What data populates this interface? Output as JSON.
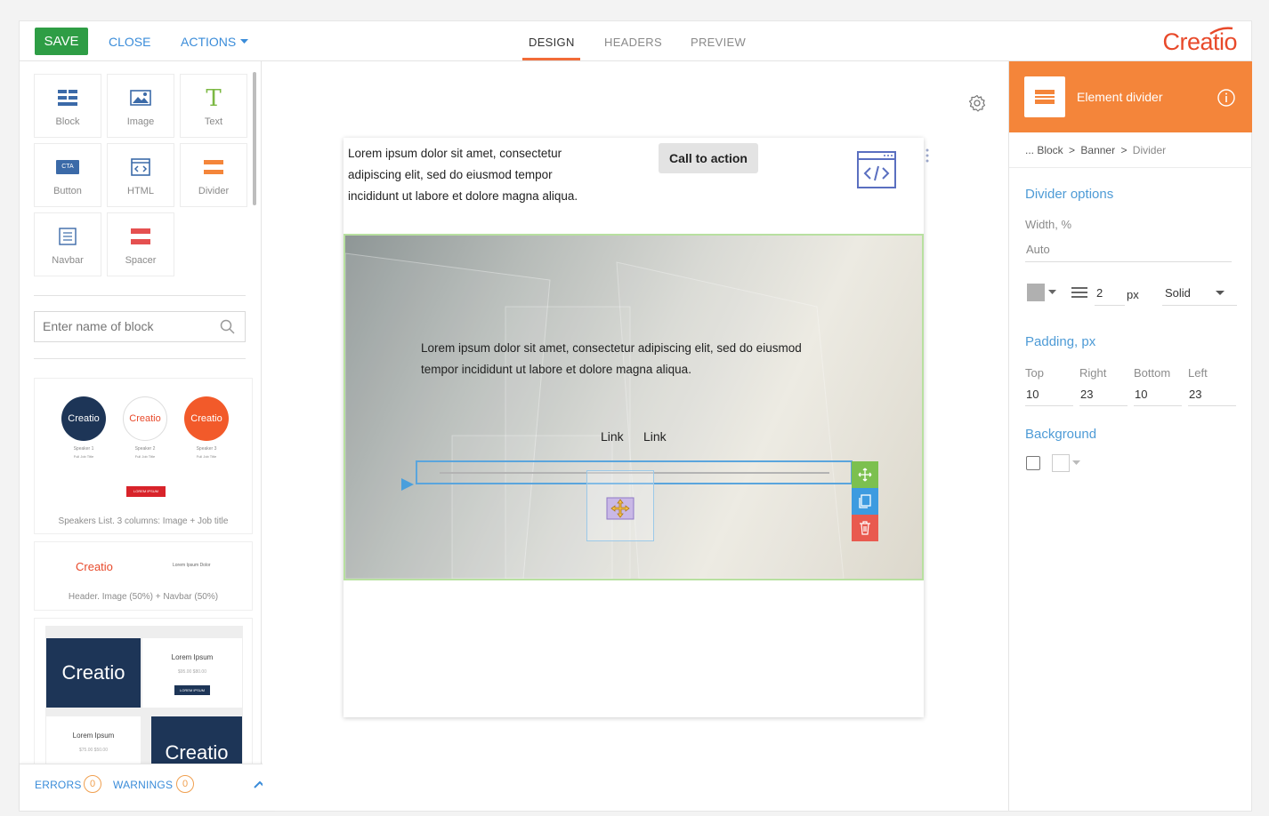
{
  "toolbar": {
    "save_label": "SAVE",
    "close_label": "CLOSE",
    "actions_label": "ACTIONS",
    "tabs": [
      "DESIGN",
      "HEADERS",
      "PREVIEW"
    ],
    "active_tab": "DESIGN",
    "logo": "Creatio"
  },
  "palette": {
    "tiles": [
      {
        "label": "Block",
        "icon": "block-icon"
      },
      {
        "label": "Image",
        "icon": "image-icon"
      },
      {
        "label": "Text",
        "icon": "text-icon"
      },
      {
        "label": "Button",
        "icon": "cta-button-icon"
      },
      {
        "label": "HTML",
        "icon": "html-icon"
      },
      {
        "label": "Divider",
        "icon": "divider-icon"
      },
      {
        "label": "Navbar",
        "icon": "navbar-icon"
      },
      {
        "label": "Spacer",
        "icon": "spacer-icon"
      }
    ],
    "cta_badge": "CTA",
    "search_placeholder": "Enter name of block",
    "templates": [
      {
        "caption": "Speakers List. 3 columns: Image + Job title",
        "circles": [
          "Creatio",
          "Creatio",
          "Creatio"
        ],
        "speakers": [
          "Speaker 1",
          "Speaker 2",
          "Speaker 3"
        ],
        "subtitle": "Full Job Title",
        "button": "LOREM IPSUM"
      },
      {
        "caption": "Header. Image (50%) + Navbar (50%)",
        "logo": "Creatio",
        "nav": "Lorem  Ipsum  Dolor"
      },
      {
        "logo": "Creatio",
        "title": "Lorem Ipsum",
        "price": "$95.00 $80.00",
        "button": "LOREM IPSUM",
        "title2": "Lorem Ipsum",
        "price2": "$75.00 $50.00"
      }
    ]
  },
  "status": {
    "errors_label": "ERRORS",
    "errors_count": "0",
    "warnings_label": "WARNINGS",
    "warnings_count": "0"
  },
  "canvas": {
    "top_text": "Lorem ipsum dolor sit amet, consectetur adipiscing elit, sed do eiusmod tempor incididunt ut labore et dolore magna aliqua.",
    "cta_label": "Call to action",
    "banner_text": "Lorem ipsum dolor sit amet, consectetur adipiscing elit, sed do eiusmod tempor incididunt ut labore et dolore magna aliqua.",
    "links": [
      "Link",
      "Link"
    ]
  },
  "inspector": {
    "title": "Element divider",
    "breadcrumbs": [
      "... Block",
      ">",
      "Banner",
      ">",
      "Divider"
    ],
    "divider_options_heading": "Divider options",
    "width_label": "Width, %",
    "width_value": "Auto",
    "thickness": "2",
    "unit": "px",
    "style": "Solid",
    "line_color": "#b0b0b0",
    "padding_heading": "Padding, px",
    "padding": [
      {
        "label": "Top",
        "value": "10"
      },
      {
        "label": "Right",
        "value": "23"
      },
      {
        "label": "Bottom",
        "value": "10"
      },
      {
        "label": "Left",
        "value": "23"
      }
    ],
    "background_heading": "Background"
  },
  "colors": {
    "accent": "#f4853a",
    "save": "#2e9d45",
    "link": "#3a8cd9",
    "logo": "#e8492a"
  }
}
